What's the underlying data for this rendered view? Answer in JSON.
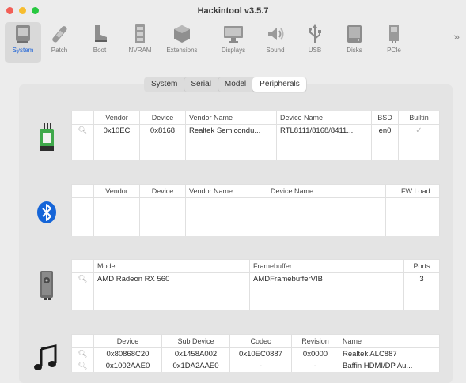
{
  "app": {
    "title": "Hackintool v3.5.7"
  },
  "toolbar": {
    "items": [
      {
        "label": "System",
        "icon": "system-icon",
        "active": true
      },
      {
        "label": "Patch",
        "icon": "patch-icon"
      },
      {
        "label": "Boot",
        "icon": "boot-icon"
      },
      {
        "label": "NVRAM",
        "icon": "nvram-icon"
      },
      {
        "label": "Extensions",
        "icon": "extensions-icon"
      },
      {
        "label": "Displays",
        "icon": "displays-icon"
      },
      {
        "label": "Sound",
        "icon": "sound-icon"
      },
      {
        "label": "USB",
        "icon": "usb-icon"
      },
      {
        "label": "Disks",
        "icon": "disks-icon"
      },
      {
        "label": "PCIe",
        "icon": "pcie-icon"
      }
    ],
    "more": "»"
  },
  "tabs": [
    {
      "label": "System"
    },
    {
      "label": "Serial"
    },
    {
      "label": "Model"
    },
    {
      "label": "Peripherals",
      "selected": true
    }
  ],
  "network": {
    "headers": [
      "Vendor",
      "Device",
      "Vendor Name",
      "Device Name",
      "BSD",
      "Builtin"
    ],
    "rows": [
      {
        "vendor": "0x10EC",
        "device": "0x8168",
        "vendor_name": "Realtek Semicondu...",
        "device_name": "RTL8111/8168/8411...",
        "bsd": "en0",
        "builtin": "✓"
      }
    ]
  },
  "bluetooth": {
    "headers": [
      "Vendor",
      "Device",
      "Vendor Name",
      "Device Name",
      "FW Load..."
    ]
  },
  "graphics": {
    "headers": [
      "Model",
      "Framebuffer",
      "Ports"
    ],
    "rows": [
      {
        "model": "AMD Radeon RX 560",
        "framebuffer": "AMDFramebufferVIB",
        "ports": "3"
      }
    ]
  },
  "audio": {
    "headers": [
      "Device",
      "Sub Device",
      "Codec",
      "Revision",
      "Name"
    ],
    "rows": [
      {
        "device": "0x80868C20",
        "sub_device": "0x1458A002",
        "codec": "0x10EC0887",
        "revision": "0x0000",
        "name": "Realtek ALC887"
      },
      {
        "device": "0x1002AAE0",
        "sub_device": "0x1DA2AAE0",
        "codec": "-",
        "revision": "-",
        "name": "Baffin HDMI/DP Au..."
      }
    ]
  },
  "colors": {
    "accent": "#1f64d8",
    "bluetooth": "#1565d8",
    "close": "#f25f57",
    "minimize": "#f7bd2f",
    "zoom": "#28c840"
  }
}
